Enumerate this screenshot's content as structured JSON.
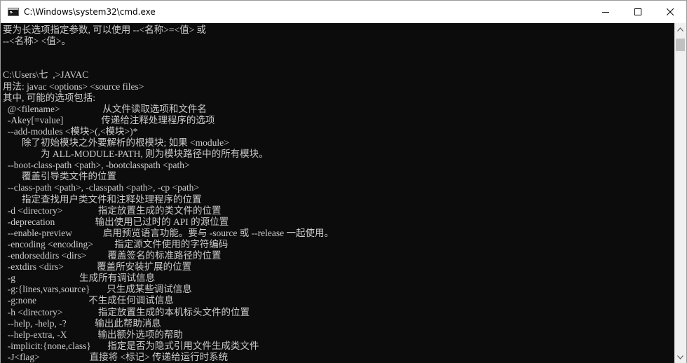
{
  "window": {
    "title": "C:\\Windows\\system32\\cmd.exe",
    "app_icon": "console-app-icon",
    "controls": [
      "minimize-icon",
      "maximize-icon",
      "close-icon"
    ]
  },
  "console": {
    "foreground": "#cccccc",
    "background": "#0c0c0c",
    "lines": [
      "要为长选项指定参数, 可以使用 --<名称>=<值> 或",
      "--<名称> <值>。",
      "",
      "",
      "C:\\Users\\七  ,>JAVAC",
      "用法: javac <options> <source files>",
      "其中, 可能的选项包括:",
      "  @<filename>                  从文件读取选项和文件名",
      "  -Akey[=value]                传递给注释处理程序的选项",
      "  --add-modules <模块>(,<模块>)*",
      "        除了初始模块之外要解析的根模块; 如果 <module>",
      "                为 ALL-MODULE-PATH, 则为模块路径中的所有模块。",
      "  --boot-class-path <path>, -bootclasspath <path>",
      "        覆盖引导类文件的位置",
      "  --class-path <path>, -classpath <path>, -cp <path>",
      "        指定查找用户类文件和注释处理程序的位置",
      "  -d <directory>               指定放置生成的类文件的位置",
      "  -deprecation                 输出使用已过时的 API 的源位置",
      "  --enable-preview             启用预览语言功能。要与 -source 或 --release 一起使用。",
      "  -encoding <encoding>         指定源文件使用的字符编码",
      "  -endorseddirs <dirs>         覆盖签名的标准路径的位置",
      "  -extdirs <dirs>              覆盖所安装扩展的位置",
      "  -g                           生成所有调试信息",
      "  -g:{lines,vars,source}       只生成某些调试信息",
      "  -g:none                      不生成任何调试信息",
      "  -h <directory>               指定放置生成的本机标头文件的位置",
      "  --help, -help, -?            输出此帮助消息",
      "  --help-extra, -X             输出额外选项的帮助",
      "  -implicit:{none,class}       指定是否为隐式引用文件生成类文件",
      "  -J<flag>                     直接将 <标记> 传递给运行时系统"
    ]
  },
  "scrollbar": {
    "up_icon": "scroll-up-arrow-icon",
    "down_icon": "scroll-down-arrow-icon",
    "position": 0.0
  }
}
